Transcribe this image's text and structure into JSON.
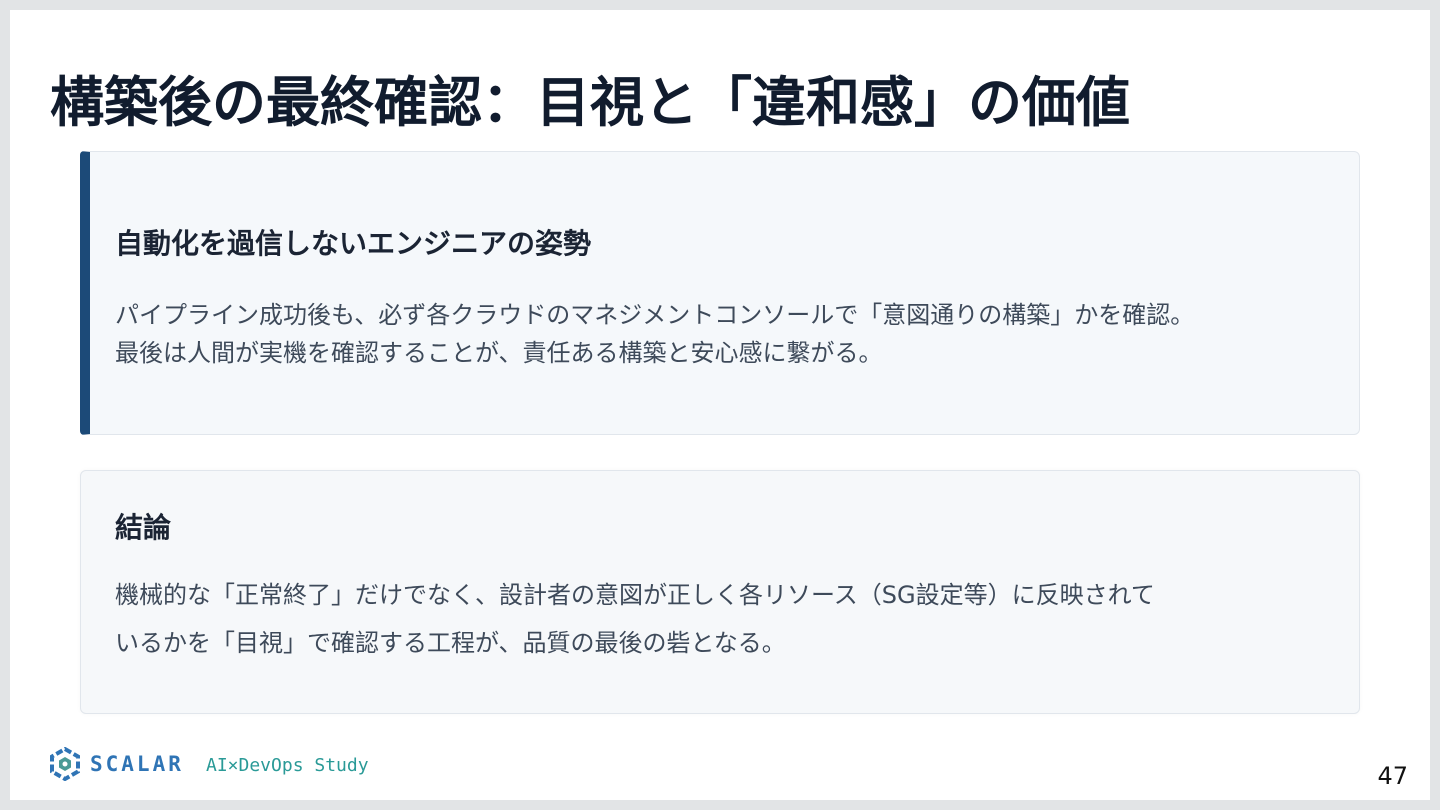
{
  "slide": {
    "title": "構築後の最終確認：目視と「違和感」の価値",
    "page_number": "47"
  },
  "cards": [
    {
      "heading": "自動化を過信しないエンジニアの姿勢",
      "lines": [
        "パイプライン成功後も、必ず各クラウドのマネジメントコンソールで「意図通りの構築」かを確認。",
        "最後は人間が実機を確認することが、責任ある構築と安心感に繋がる。"
      ]
    },
    {
      "heading": "結論",
      "lines": [
        "機械的な「正常終了」だけでなく、設計者の意図が正しく各リソース（SG設定等）に反映されて",
        "いるかを「目視」で確認する工程が、品質の最後の砦となる。"
      ]
    }
  ],
  "footer": {
    "brand_name": "SCALAR",
    "tagline": "AI×DevOps Study",
    "logo_icon": "scalar-logo-icon"
  },
  "colors": {
    "accent_bar": "#1c4a78",
    "brand_blue": "#2f74b5",
    "tagline_teal": "#2a9a97",
    "title_text": "#111c2e"
  }
}
